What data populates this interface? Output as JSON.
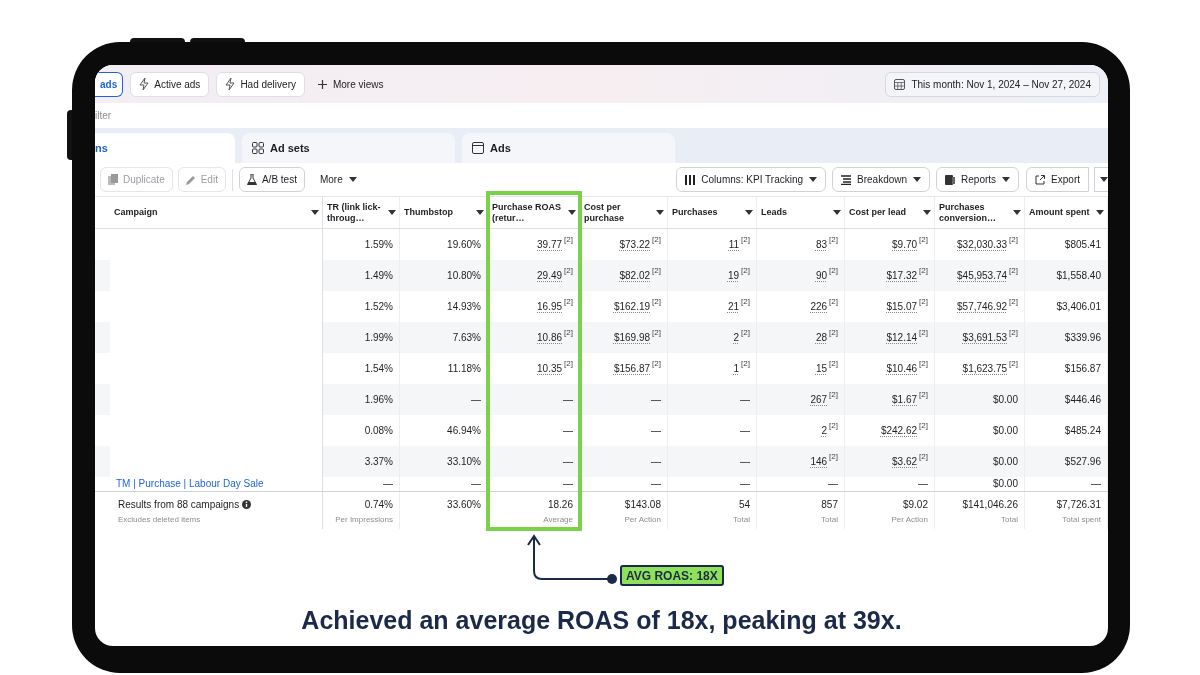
{
  "top_bar": {
    "views": [
      {
        "label": "ads",
        "selected": true
      },
      {
        "label": "Active ads",
        "selected": false
      },
      {
        "label": "Had delivery",
        "selected": false
      }
    ],
    "more_views": "More views",
    "date_range": "This month: Nov 1, 2024 – Nov 27, 2024"
  },
  "filter": {
    "placeholder": "ilter"
  },
  "level_tabs": [
    {
      "label": "ns",
      "selected": true
    },
    {
      "label": "Ad sets",
      "selected": false
    },
    {
      "label": "Ads",
      "selected": false
    }
  ],
  "toolbar": {
    "left": [
      {
        "label": "Duplicate",
        "disabled": true
      },
      {
        "label": "Edit",
        "disabled": true
      },
      {
        "label": "A/B test",
        "disabled": false
      }
    ],
    "more": "More",
    "right": [
      {
        "label": "Columns: KPI Tracking"
      },
      {
        "label": "Breakdown"
      },
      {
        "label": "Reports"
      },
      {
        "label": "Export"
      }
    ]
  },
  "table": {
    "columns": [
      {
        "label": "Campaign",
        "highlighted": false
      },
      {
        "label": "TR (link lick-throug…",
        "highlighted": false
      },
      {
        "label": "Thumbstop",
        "highlighted": false
      },
      {
        "label": "Purchase ROAS (retur…",
        "highlighted": true
      },
      {
        "label": "Cost per purchase",
        "highlighted": false
      },
      {
        "label": "Purchases",
        "highlighted": false
      },
      {
        "label": "Leads",
        "highlighted": false
      },
      {
        "label": "Cost per lead",
        "highlighted": false
      },
      {
        "label": "Purchases conversion…",
        "highlighted": false
      },
      {
        "label": "Amount spent",
        "highlighted": false
      }
    ],
    "rows": [
      {
        "cells": [
          {
            "text": "1.59%"
          },
          {
            "text": "19.60%"
          },
          {
            "text": "39.77",
            "note": "[2]"
          },
          {
            "text": "$73.22",
            "note": "[2]"
          },
          {
            "text": "11",
            "note": "[2]"
          },
          {
            "text": "83",
            "note": "[2]"
          },
          {
            "text": "$9.70",
            "note": "[2]"
          },
          {
            "text": "$32,030.33",
            "note": "[2]"
          },
          {
            "text": "$805.41"
          }
        ]
      },
      {
        "cells": [
          {
            "text": "1.49%"
          },
          {
            "text": "10.80%"
          },
          {
            "text": "29.49",
            "note": "[2]"
          },
          {
            "text": "$82.02",
            "note": "[2]"
          },
          {
            "text": "19",
            "note": "[2]"
          },
          {
            "text": "90",
            "note": "[2]"
          },
          {
            "text": "$17.32",
            "note": "[2]"
          },
          {
            "text": "$45,953.74",
            "note": "[2]"
          },
          {
            "text": "$1,558.40"
          }
        ]
      },
      {
        "cells": [
          {
            "text": "1.52%"
          },
          {
            "text": "14.93%"
          },
          {
            "text": "16.95",
            "note": "[2]"
          },
          {
            "text": "$162.19",
            "note": "[2]"
          },
          {
            "text": "21",
            "note": "[2]"
          },
          {
            "text": "226",
            "note": "[2]"
          },
          {
            "text": "$15.07",
            "note": "[2]"
          },
          {
            "text": "$57,746.92",
            "note": "[2]"
          },
          {
            "text": "$3,406.01"
          }
        ]
      },
      {
        "cells": [
          {
            "text": "1.99%"
          },
          {
            "text": "7.63%"
          },
          {
            "text": "10.86",
            "note": "[2]"
          },
          {
            "text": "$169.98",
            "note": "[2]"
          },
          {
            "text": "2",
            "note": "[2]"
          },
          {
            "text": "28",
            "note": "[2]"
          },
          {
            "text": "$12.14",
            "note": "[2]"
          },
          {
            "text": "$3,691.53",
            "note": "[2]"
          },
          {
            "text": "$339.96"
          }
        ]
      },
      {
        "cells": [
          {
            "text": "1.54%"
          },
          {
            "text": "11.18%"
          },
          {
            "text": "10.35",
            "note": "[2]"
          },
          {
            "text": "$156.87",
            "note": "[2]"
          },
          {
            "text": "1",
            "note": "[2]"
          },
          {
            "text": "15",
            "note": "[2]"
          },
          {
            "text": "$10.46",
            "note": "[2]"
          },
          {
            "text": "$1,623.75",
            "note": "[2]"
          },
          {
            "text": "$156.87"
          }
        ]
      },
      {
        "cells": [
          {
            "text": "1.96%"
          },
          {
            "text": "—"
          },
          {
            "text": "—"
          },
          {
            "text": "—"
          },
          {
            "text": "—"
          },
          {
            "text": "267",
            "note": "[2]"
          },
          {
            "text": "$1.67",
            "note": "[2]"
          },
          {
            "text": "$0.00"
          },
          {
            "text": "$446.46"
          }
        ]
      },
      {
        "cells": [
          {
            "text": "0.08%"
          },
          {
            "text": "46.94%"
          },
          {
            "text": "—"
          },
          {
            "text": "—"
          },
          {
            "text": "—"
          },
          {
            "text": "2",
            "note": "[2]"
          },
          {
            "text": "$242.62",
            "note": "[2]"
          },
          {
            "text": "$0.00"
          },
          {
            "text": "$485.24"
          }
        ]
      },
      {
        "cells": [
          {
            "text": "3.37%"
          },
          {
            "text": "33.10%"
          },
          {
            "text": "—"
          },
          {
            "text": "—"
          },
          {
            "text": "—"
          },
          {
            "text": "146",
            "note": "[2]"
          },
          {
            "text": "$3.62",
            "note": "[2]"
          },
          {
            "text": "$0.00"
          },
          {
            "text": "$527.96"
          }
        ]
      },
      {
        "campaign": "TM | Purchase | Labour Day Sale",
        "cells": [
          {
            "text": "—"
          },
          {
            "text": "—"
          },
          {
            "text": "—"
          },
          {
            "text": "—"
          },
          {
            "text": "—"
          },
          {
            "text": "—"
          },
          {
            "text": "—"
          },
          {
            "text": "$0.00"
          },
          {
            "text": "—"
          }
        ]
      }
    ],
    "footer": {
      "label": "Results from 88 campaigns",
      "sub": "Excludes deleted items",
      "cells": [
        {
          "text": "0.74%",
          "sub": "Per Impressions"
        },
        {
          "text": "33.60%"
        },
        {
          "text": "18.26",
          "sub": "Average"
        },
        {
          "text": "$143.08",
          "sub": "Per Action"
        },
        {
          "text": "54",
          "sub": "Total"
        },
        {
          "text": "857",
          "sub": "Total"
        },
        {
          "text": "$9.02",
          "sub": "Per Action"
        },
        {
          "text": "$141,046.26",
          "sub": "Total"
        },
        {
          "text": "$7,726.31",
          "sub": "Total spent"
        }
      ]
    }
  },
  "annotation": {
    "badge": "AVG ROAS: 18X",
    "caption": "Achieved an average ROAS of 18x, peaking at 39x."
  }
}
